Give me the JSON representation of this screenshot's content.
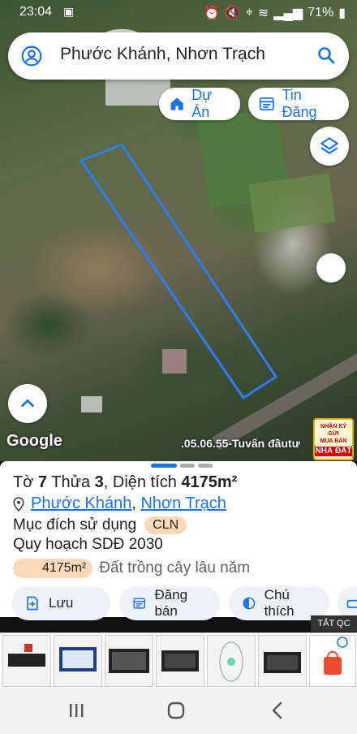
{
  "status": {
    "time": "23:04",
    "battery": "71%"
  },
  "search": {
    "query": "Phước Khánh, Nhơn Trạch"
  },
  "chips": {
    "du_an": "Dự Án",
    "tin_dang": "Tin Đăng"
  },
  "map": {
    "logo": "Google",
    "caption": ".05.06.55-Tuvấn đầutư",
    "promo_lines": [
      "NHẬN KÝ GỬI",
      "MUA BÁN"
    ],
    "promo_big": "NHÀ ĐẤT"
  },
  "parcel": {
    "to_label": "Tờ",
    "to": "7",
    "thua_label": "Thửa",
    "thua": "3",
    "dien_tich_label": ", Diện tích",
    "area": "4175m²",
    "ward": "Phước Khánh",
    "separator": ",",
    "district": "Nhơn Trạch",
    "purpose_label": "Mục đích sử dụng",
    "purpose_code": "CLN",
    "plan_label": "Quy hoạch SDĐ 2030",
    "plan_area": "4175m²",
    "plan_desc": "Đất trồng cây lâu năm"
  },
  "actions": {
    "save": "Lưu",
    "post": "Đăng bán",
    "note": "Chú thích"
  },
  "ads": {
    "close_label": "TẮT QC"
  }
}
